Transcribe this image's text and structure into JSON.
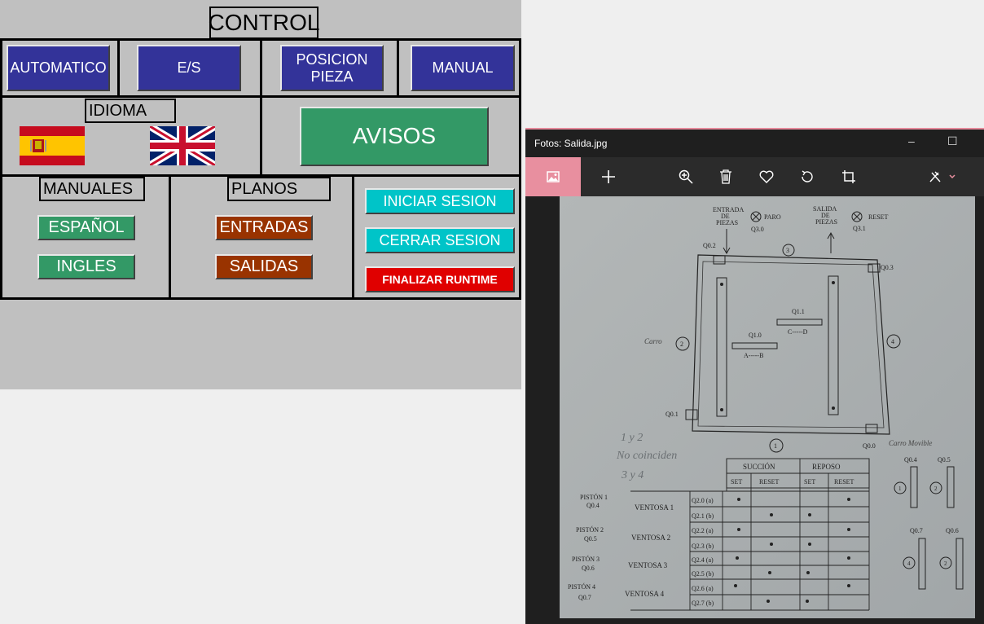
{
  "hmi": {
    "title": "CONTROL",
    "nav": [
      "AUTOMATICO",
      "E/S",
      "POSICION PIEZA",
      "MANUAL"
    ],
    "idioma_label": "IDIOMA",
    "avisos_label": "AVISOS",
    "manuales_label": "MANUALES",
    "manuales": [
      "ESPAÑOL",
      "INGLES"
    ],
    "planos_label": "PLANOS",
    "planos": [
      "ENTRADAS",
      "SALIDAS"
    ],
    "session": [
      "INICIAR SESION",
      "CERRAR SESION"
    ],
    "finalizar": "FINALIZAR RUNTIME"
  },
  "viewer": {
    "title": "Fotos: Salida.jpg",
    "minimize": "–",
    "maximize": "☐",
    "toolbar_icons": [
      "image-icon",
      "add-icon",
      "zoom-icon",
      "delete-icon",
      "favorite-icon",
      "rotate-icon",
      "crop-icon",
      "edit-icon"
    ]
  },
  "drawing": {
    "entrada": [
      "ENTRADA",
      "DE",
      "PIEZAS"
    ],
    "paro": "PARO",
    "q30": "Q3.0",
    "salida": [
      "SALIDA",
      "DE",
      "PIEZAS"
    ],
    "reset": "RESET",
    "q31": "Q3.1",
    "q02": "Q0.2",
    "q03": "Q0.3",
    "q01": "Q0.1",
    "q00": "Q0.0",
    "q11": "Q1.1",
    "q10": "Q1.0",
    "cd": "C-----D",
    "ab": "A-----B",
    "carro_left": "Carro",
    "carro_right": "Carro Movible",
    "circles": [
      "3",
      "2",
      "4",
      "1"
    ],
    "note": [
      "1 y 2",
      "No coinciden",
      "3 y 4"
    ],
    "table": {
      "succion": "SUCCIÓN",
      "reposo": "REPOSO",
      "sub": [
        "SET",
        "RESET",
        "SET",
        "RESET"
      ],
      "pistones": [
        "PISTÓN 1",
        "Q0.4",
        "PISTÓN 2",
        "Q0.5",
        "PISTÓN 3",
        "Q0.6",
        "PISTÓN 4",
        "Q0.7"
      ],
      "ventosas": [
        "VENTOSA 1",
        "VENTOSA 2",
        "VENTOSA 3",
        "VENTOSA 4"
      ],
      "outputs": [
        "Q2.0 (a)",
        "Q2.1 (b)",
        "Q2.2 (a)",
        "Q2.3 (b)",
        "Q2.4 (a)",
        "Q2.5 (b)",
        "Q2.6 (a)",
        "Q2.7 (b)"
      ]
    },
    "pistons": [
      "Q0.4",
      "Q0.5",
      "Q0.7",
      "Q0.6"
    ],
    "piston_nums": [
      "1",
      "2",
      "4",
      "2"
    ]
  }
}
